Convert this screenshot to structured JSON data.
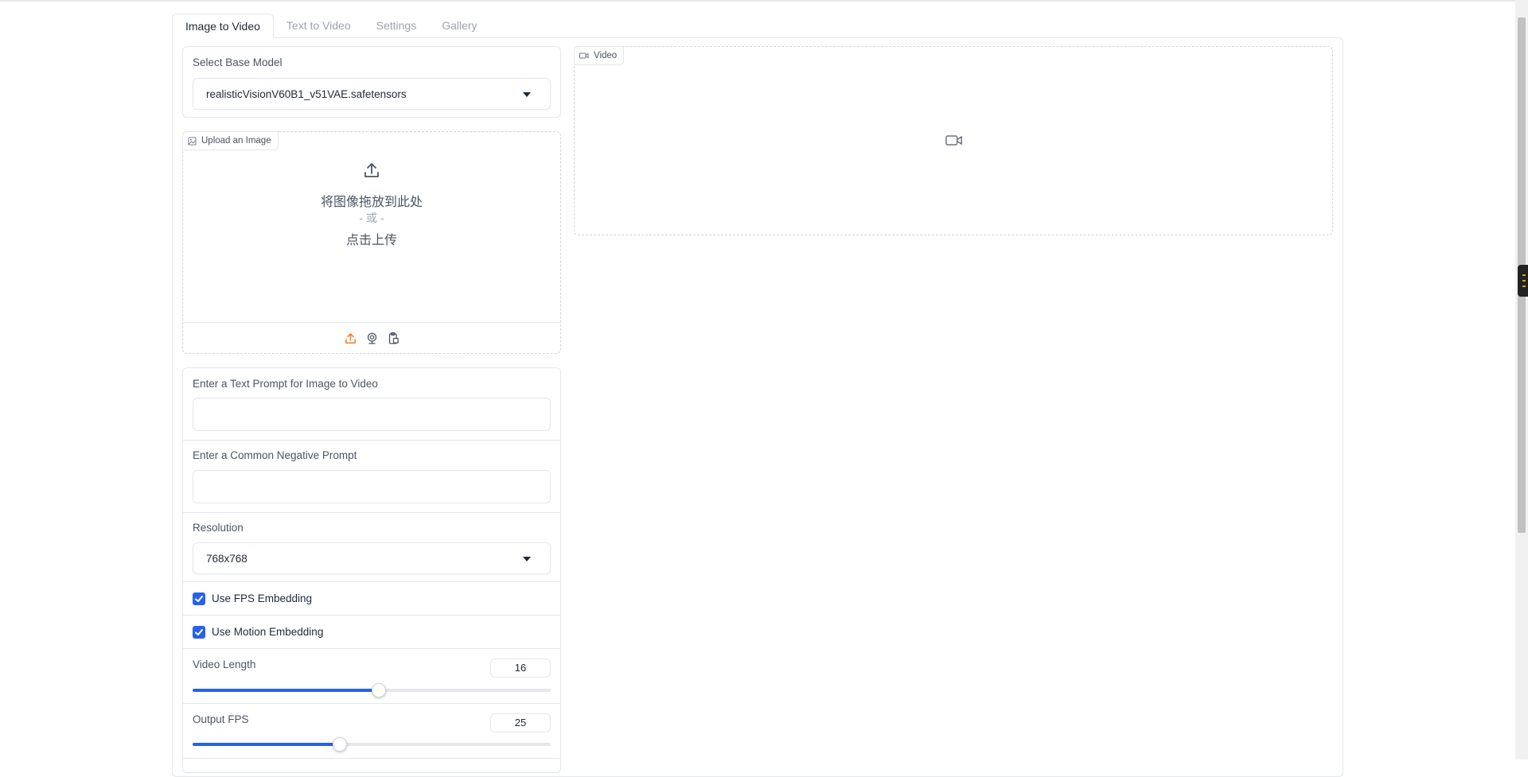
{
  "tabs": [
    {
      "label": "Image to Video",
      "active": true
    },
    {
      "label": "Text to Video",
      "active": false
    },
    {
      "label": "Settings",
      "active": false
    },
    {
      "label": "Gallery",
      "active": false
    }
  ],
  "base_model": {
    "label": "Select Base Model",
    "value": "realisticVisionV60B1_v51VAE.safetensors"
  },
  "upload": {
    "chip": "Upload an Image",
    "drop_text": "将图像拖放到此处",
    "or_text": "- 或 -",
    "click_text": "点击上传",
    "icons": [
      "upload-icon",
      "webcam-icon",
      "clipboard-icon"
    ]
  },
  "prompt": {
    "label": "Enter a Text Prompt for Image to Video",
    "value": ""
  },
  "negative_prompt": {
    "label": "Enter a Common Negative Prompt",
    "value": ""
  },
  "resolution": {
    "label": "Resolution",
    "value": "768x768"
  },
  "fps_embedding": {
    "label": "Use FPS Embedding",
    "checked": true
  },
  "motion_embedding": {
    "label": "Use Motion Embedding",
    "checked": true
  },
  "video_length": {
    "label": "Video Length",
    "value": "16",
    "fraction": 0.52
  },
  "output_fps": {
    "label": "Output FPS",
    "value": "25",
    "fraction": 0.41
  },
  "video": {
    "chip": "Video",
    "placeholder_icon": "video-camera-icon"
  },
  "colors": {
    "accent": "#2563eb",
    "upload_icon": "#f97316",
    "border": "#e5e7eb"
  }
}
